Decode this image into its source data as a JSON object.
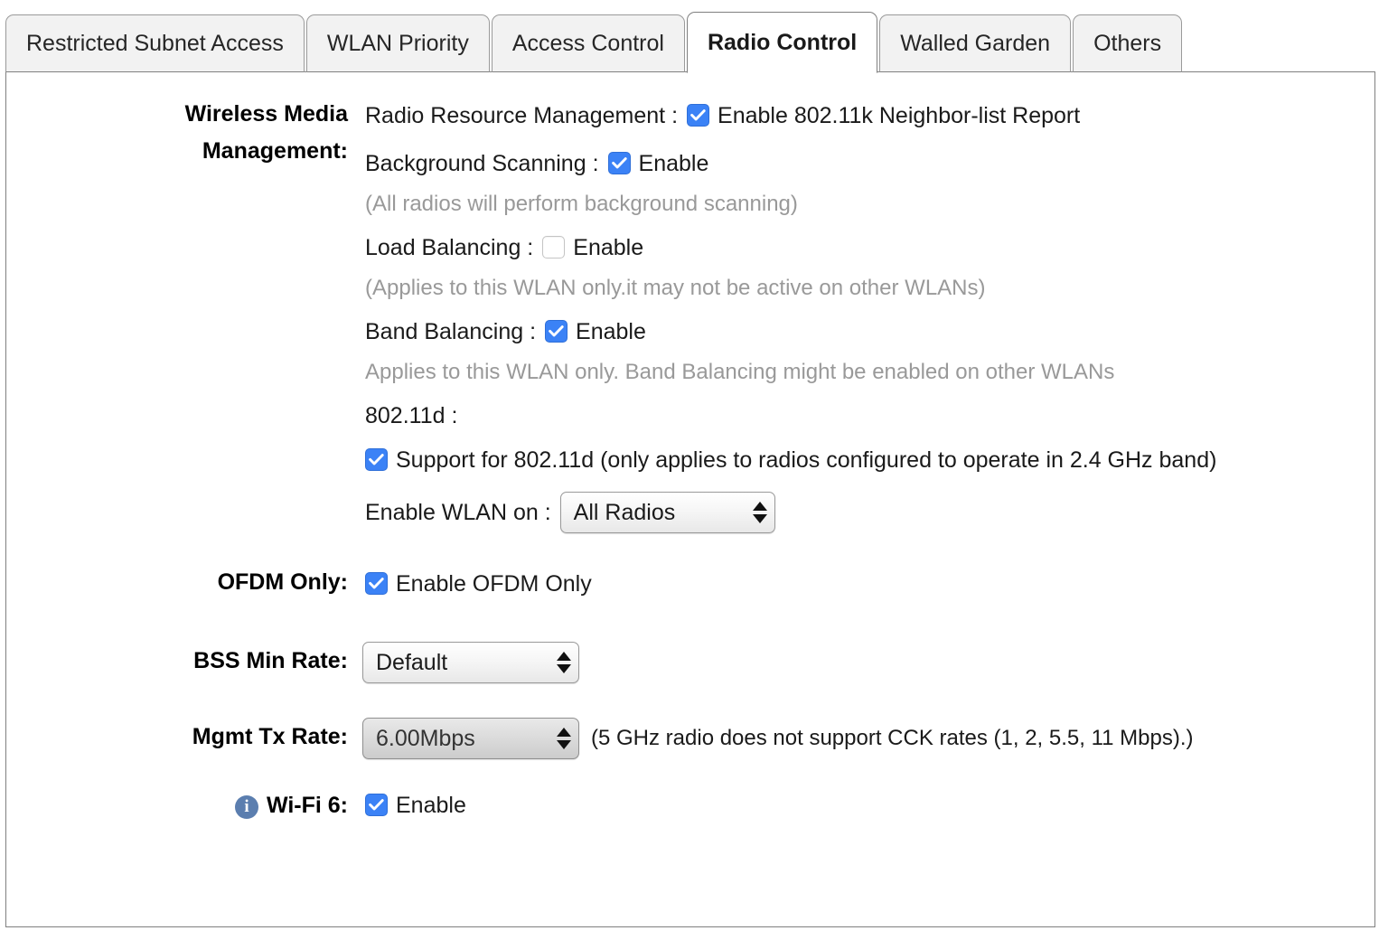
{
  "tabs": [
    {
      "label": "Restricted Subnet Access",
      "active": false
    },
    {
      "label": "WLAN Priority",
      "active": false
    },
    {
      "label": "Access Control",
      "active": false
    },
    {
      "label": "Radio Control",
      "active": true
    },
    {
      "label": "Walled Garden",
      "active": false
    },
    {
      "label": "Others",
      "active": false
    }
  ],
  "colors": {
    "checkbox_checked": "#3b82f6",
    "info_icon": "#5b7eaf",
    "hint_text": "#999999",
    "panel_border": "#808080",
    "tab_inactive_bg": "#f2f2f2"
  },
  "form": {
    "wireless_media": {
      "label_line1": "Wireless Media",
      "label_line2": "Management:",
      "rrm": {
        "prefix": "Radio Resource Management :",
        "checkbox_checked": true,
        "option_label": "Enable 802.11k Neighbor-list Report"
      },
      "background_scanning": {
        "prefix": "Background Scanning :",
        "checkbox_checked": true,
        "option_label": "Enable",
        "hint": "(All radios will perform background scanning)"
      },
      "load_balancing": {
        "prefix": "Load Balancing :",
        "checkbox_checked": false,
        "option_label": "Enable",
        "hint": "(Applies to this WLAN only.it may not be active on other WLANs)"
      },
      "band_balancing": {
        "prefix": "Band Balancing :",
        "checkbox_checked": true,
        "option_label": "Enable",
        "hint": "Applies to this WLAN only. Band Balancing might be enabled on other WLANs"
      },
      "dot11d": {
        "prefix": "802.11d :",
        "checkbox_checked": true,
        "option_label": "Support for 802.11d (only applies to radios configured to operate in 2.4 GHz band)"
      },
      "enable_wlan_on": {
        "prefix": "Enable WLAN on :",
        "selected": "All Radios"
      }
    },
    "ofdm_only": {
      "label": "OFDM Only:",
      "checkbox_checked": true,
      "option_label": "Enable OFDM Only"
    },
    "bss_min_rate": {
      "label": "BSS Min Rate:",
      "selected": "Default"
    },
    "mgmt_tx_rate": {
      "label": "Mgmt Tx Rate:",
      "selected": "6.00Mbps",
      "note": "(5 GHz radio does not support CCK rates (1, 2, 5.5, 11 Mbps).)"
    },
    "wifi6": {
      "info_icon": "info-icon",
      "label": "Wi-Fi 6:",
      "checkbox_checked": true,
      "option_label": "Enable"
    }
  }
}
